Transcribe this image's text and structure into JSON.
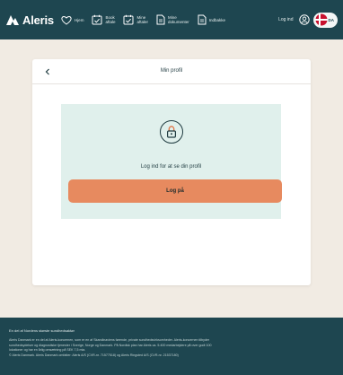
{
  "header": {
    "brand": "Aleris",
    "nav": [
      {
        "label": "Hjem",
        "icon": "heart-icon"
      },
      {
        "label": "Book\naftale",
        "icon": "calendar-check-icon"
      },
      {
        "label": "Mine\naftaler",
        "icon": "calendar-list-icon"
      },
      {
        "label": "Mine\ndokumenter",
        "icon": "document-icon"
      },
      {
        "label": "Indbakke",
        "icon": "inbox-icon"
      }
    ],
    "login_label": "Log ind",
    "language": "DA"
  },
  "card": {
    "back_label": "<",
    "title": "Min profil",
    "prompt": "Log ind for at se din profil",
    "button_label": "Log på"
  },
  "footer": {
    "tagline": "En del af Nordens største sundhedsaktør",
    "lines": [
      "Aleris Danmark er en del af Aleris-koncernen, som er en af Skandinaviens førende, private sundhedsvirksomheder. Aleris-koncernen tilbyder",
      "sundhedsydelser og diagnostiske tjenester i Sverige, Norge og Danmark. På Nordisk plan har Aleris ca. 5.400 medarbejdere på over godt 100",
      "lokationer og har en årlig omsætning på SEK 7,5 mia.",
      "© Aleris Danmark. Aleris Danmark omfatter: Aleris A/S (CVR-nr. 71577518) og Aleris Ringsted A/S (CVR-nr. 21537180)"
    ]
  },
  "colors": {
    "header_bg": "#1e4650",
    "page_bg": "#f1ebe3",
    "panel_bg": "#e0f0ec",
    "button_bg": "#e78a5f"
  }
}
